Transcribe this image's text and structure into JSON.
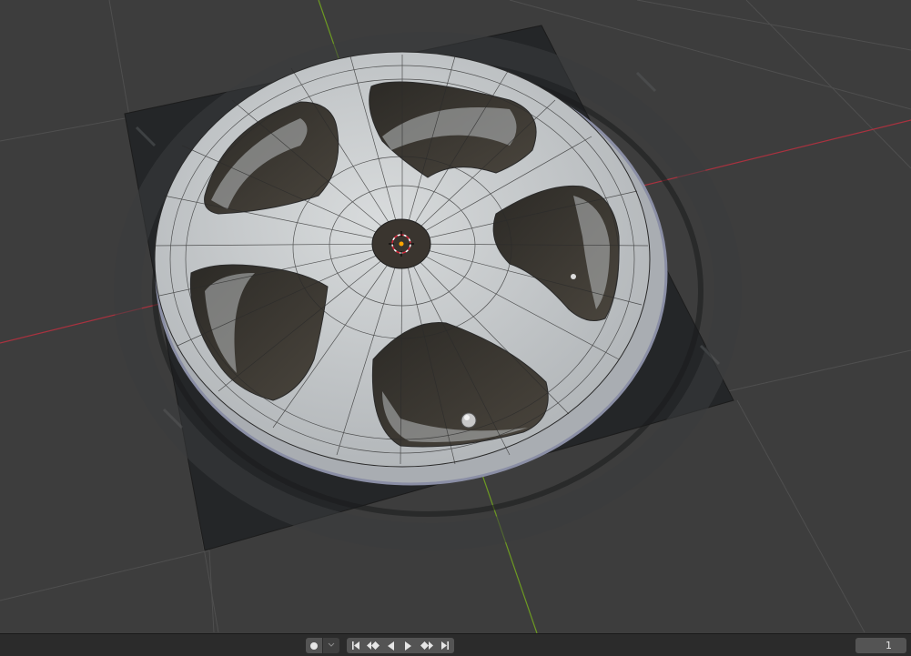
{
  "viewport": {
    "description_name": "3D Viewport",
    "grid_color": "#4f4f4f",
    "axis_x_color": "#a8323f",
    "axis_y_color": "#6d9a22",
    "wheel_face_color": "#c6c9cb",
    "wheel_edge_color": "#9fa3a6",
    "tire_color": "#26282a"
  },
  "timeline": {
    "record_icon": "record-dot-icon",
    "record_dropdown_icon": "chevron-down-icon",
    "controls": [
      {
        "name": "jump-to-start-button",
        "icon": "jump-start-icon"
      },
      {
        "name": "jump-to-prev-keyframe-button",
        "icon": "prev-keyframe-icon"
      },
      {
        "name": "play-reverse-button",
        "icon": "play-reverse-icon"
      },
      {
        "name": "play-button",
        "icon": "play-icon"
      },
      {
        "name": "jump-to-next-keyframe-button",
        "icon": "next-keyframe-icon"
      },
      {
        "name": "jump-to-end-button",
        "icon": "jump-end-icon"
      }
    ],
    "current_frame": "1"
  }
}
